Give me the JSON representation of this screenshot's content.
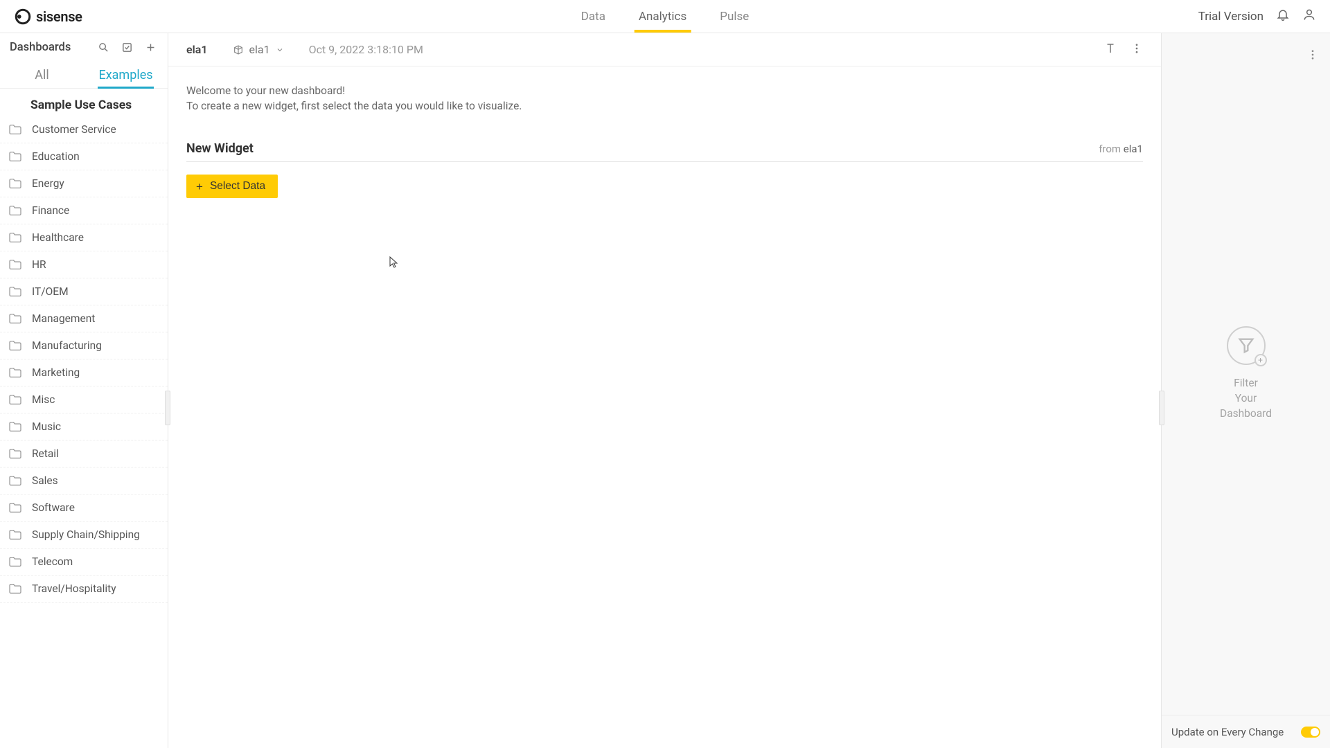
{
  "brand": "sisense",
  "nav": {
    "tabs": [
      "Data",
      "Analytics",
      "Pulse"
    ],
    "active": 1
  },
  "topbar": {
    "trial": "Trial Version"
  },
  "sidebar": {
    "title": "Dashboards",
    "tabs": {
      "all": "All",
      "examples": "Examples",
      "active": 1
    },
    "section_title": "Sample Use Cases",
    "folders": [
      "Customer Service",
      "Education",
      "Energy",
      "Finance",
      "Healthcare",
      "HR",
      "IT/OEM",
      "Management",
      "Manufacturing",
      "Marketing",
      "Misc",
      "Music",
      "Retail",
      "Sales",
      "Software",
      "Supply Chain/Shipping",
      "Telecom",
      "Travel/Hospitality"
    ]
  },
  "dashboard": {
    "name": "ela1",
    "datasource": "ela1",
    "timestamp": "Oct 9, 2022 3:18:10 PM",
    "welcome_title": "Welcome to your new dashboard!",
    "welcome_sub": "To create a new widget, first select the data you would like to visualize.",
    "widget_title": "New Widget",
    "from_label": "from",
    "from_source": "ela1",
    "select_data_label": "Select Data"
  },
  "filter_panel": {
    "line1": "Filter",
    "line2": "Your",
    "line3": "Dashboard",
    "footer_label": "Update on Every Change"
  }
}
